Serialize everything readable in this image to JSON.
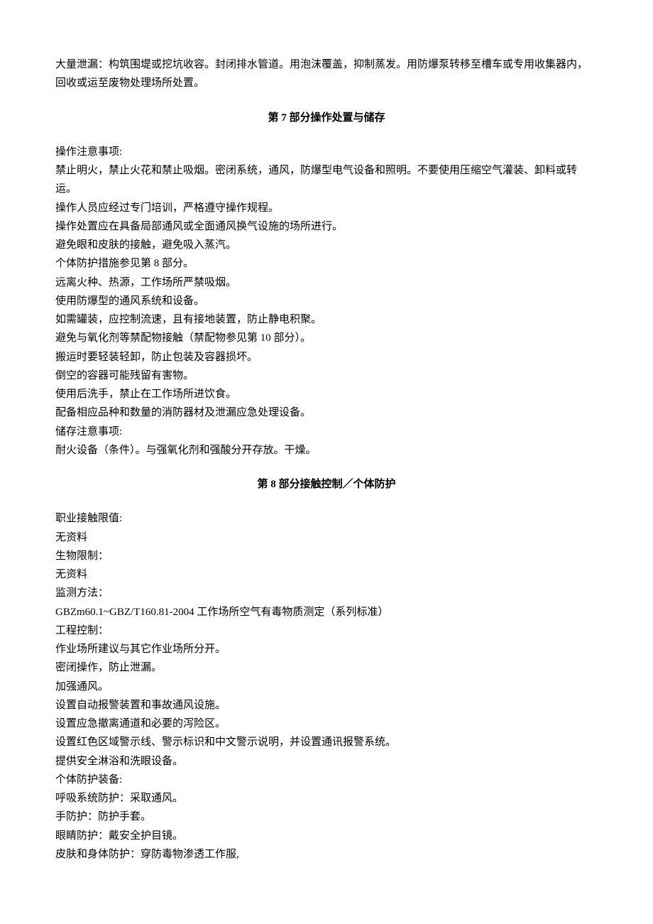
{
  "intro": {
    "p1": "大量泄漏：构筑围堤或挖坑收容。封闭排水管道。用泡沫覆盖，抑制蒸发。用防爆泵转移至槽车或专用收集器内，回收或运至废物处理场所处置。"
  },
  "section7": {
    "heading": "第 7 部分操作处置与储存",
    "lines": [
      "操作注意事项:",
      "禁止明火，禁止火花和禁止吸烟。密闭系统，通风，防爆型电气设备和照明。不要使用压缩空气灌装、卸料或转运。",
      "操作人员应经过专门培训，严格遵守操作规程。",
      "操作处置应在具备局部通风或全面通风换气设施的场所进行。",
      "避免眼和皮肤的接触，避免吸入蒸汽。",
      "个体防护措施参见第 8 部分。",
      "远离火种、热源，工作场所严禁吸烟。",
      "使用防爆型的通风系统和设备。",
      "如需罐装，应控制流速，且有接地装置，防止静电积聚。",
      "避免与氧化剂等禁配物接触（禁配物参见第 10 部分）。",
      "搬运时要轻装轻卸，防止包装及容器损坏。",
      "倒空的容器可能残留有害物。",
      "使用后洗手，禁止在工作场所进饮食。",
      "配备相应品种和数量的消防器材及泄漏应急处理设备。",
      "储存注意事项:",
      "耐火设备（条件）。与强氧化剂和强酸分开存放。干燥。"
    ]
  },
  "section8": {
    "heading": "第 8 部分接触控制／个体防护",
    "lines": [
      "职业接触限值:",
      "无资料",
      "生物限制：",
      "无资料",
      "监测方法：",
      "GBZm60.1~GBZ/T160.81-2004 工作场所空气有毒物质测定（系列标准）",
      "工程控制：",
      "作业场所建议与其它作业场所分开。",
      "密闭操作，防止泄漏。",
      "加强通风。",
      "设置自动报警装置和事故通风设施。",
      "设置应急撤离通道和必要的泻险区。",
      "设置红色区域警示线、警示标识和中文警示说明，并设置通讯报警系统。",
      "提供安全淋浴和洗眼设备。",
      "个体防护装备:",
      "呼吸系统防护：采取通风。",
      "手防护：防护手套。",
      "眼睛防护：戴安全护目镜。",
      "皮肤和身体防护：穿防毒物渗透工作服,"
    ]
  }
}
